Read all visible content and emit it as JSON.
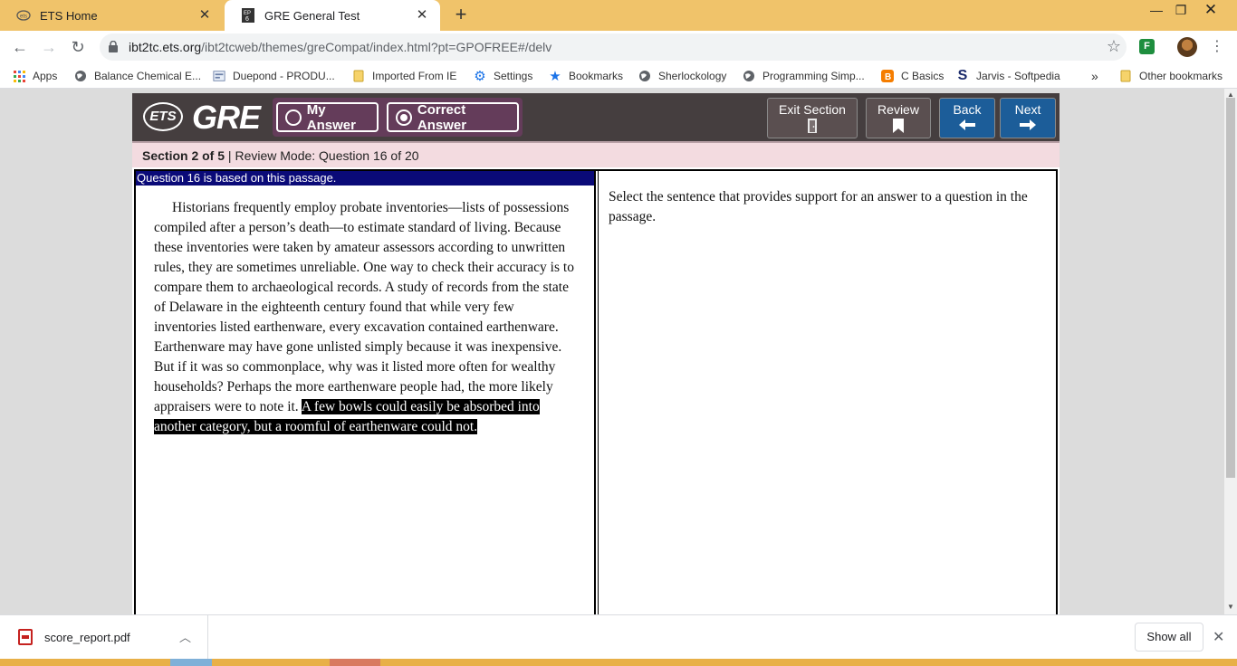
{
  "browser": {
    "tabs": [
      {
        "title": "ETS Home",
        "favicon": "ets-favicon"
      },
      {
        "title": "GRE General Test",
        "favicon": "gre-favicon"
      }
    ],
    "url_host": "ibt2tc.ets.org",
    "url_path": "/ibt2tcweb/themes/greCompat/index.html?pt=GPOFREE#/delv",
    "bookmarks": [
      {
        "label": "Apps",
        "icon": "apps-grid-icon"
      },
      {
        "label": "Balance Chemical E...",
        "icon": "globe-icon"
      },
      {
        "label": "Duepond - PRODU...",
        "icon": "page-icon"
      },
      {
        "label": "Imported From IE",
        "icon": "folder-icon"
      },
      {
        "label": "Settings",
        "icon": "gear-icon"
      },
      {
        "label": "Bookmarks",
        "icon": "star-icon"
      },
      {
        "label": "Sherlockology",
        "icon": "globe-icon"
      },
      {
        "label": "Programming Simp...",
        "icon": "globe-icon"
      },
      {
        "label": "C Basics",
        "icon": "blogger-icon"
      },
      {
        "label": "Jarvis - Softpedia",
        "icon": "softpedia-icon"
      }
    ],
    "overflow": "»",
    "other_bookmarks": "Other bookmarks"
  },
  "app": {
    "buttons": {
      "my_answer": "My Answer",
      "correct_answer": "Correct Answer",
      "exit_section": "Exit Section",
      "review": "Review",
      "back": "Back",
      "next": "Next"
    },
    "status": {
      "section": "Section 2 of 5",
      "separator": " | ",
      "mode": "Review Mode: Question 16 of 20"
    },
    "passage_header": "Question 16 is based on this passage.",
    "passage_text": "Historians frequently employ probate inventories—lists of possessions compiled after a person’s death—to estimate standard of living. Because these inventories were taken by amateur assessors according to unwritten rules, they are sometimes unreliable. One way to check their accuracy is to compare them to archaeological records. A study of records from the state of Delaware in the eighteenth century found that while very few inventories listed earthenware, every excavation contained earthenware. Earthenware may have gone unlisted simply because it was inexpensive. But if it was so commonplace, why was it listed more often for wealthy households? Perhaps the more earthenware people had, the more likely appraisers were to note it.",
    "passage_highlight": "A few bowls could easily be absorbed into another category, but a roomful of earthenware could not.",
    "instruction": "Select the sentence that provides support for an answer to a question in the passage."
  },
  "downloads": {
    "file_name": "score_report.pdf",
    "show_all": "Show all"
  },
  "colors": {
    "tab_strip": "#f0c36a",
    "gre_header": "#453e3f",
    "answer_toggle": "#643c5a",
    "nav_blue": "#1c5d99",
    "status_bar": "#f3dbe0",
    "passage_header": "#0a0a78"
  }
}
